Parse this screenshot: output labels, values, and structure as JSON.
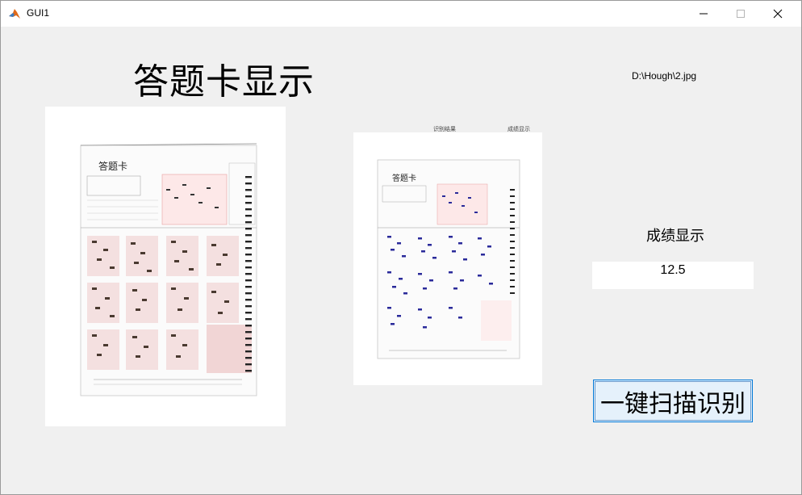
{
  "window": {
    "title": "GUI1"
  },
  "heading": "答题卡显示",
  "file_path": "D:\\Hough\\2.jpg",
  "score": {
    "label": "成绩显示",
    "value": "12.5"
  },
  "scan_button": {
    "label": "一键扫描识别"
  },
  "sheet": {
    "title": "答题卡"
  },
  "preview_captions": {
    "left": "识别结果",
    "right": "成绩显示"
  },
  "colors": {
    "accent_border": "#0078d7",
    "button_fill": "#e5f1fb",
    "panel_bg": "#f0f0f0",
    "mark_blue": "#2a2a9a"
  }
}
